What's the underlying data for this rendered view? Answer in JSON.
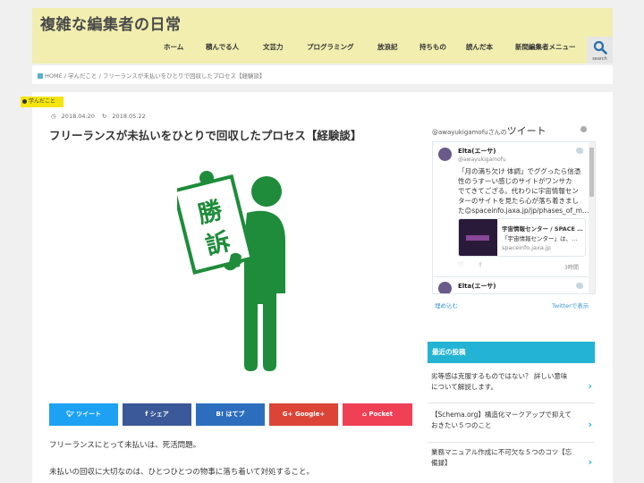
{
  "site": {
    "title": "複雑な編集者の日常",
    "search_label": "search",
    "nav": [
      "ホーム",
      "積んでる人",
      "文芸力",
      "プログラミング",
      "放浪記",
      "持ちもの",
      "読んだ本",
      "新間編集者メニュー"
    ]
  },
  "breadcrumb": "HOME / 学んだこと / フリーランスが未払いをひとりで回収したプロセス【経験談】",
  "post": {
    "category": "学んだこと",
    "published": "2018.04.20",
    "updated": "2018.05.22",
    "title": "フリーランスが未払いをひとりで回収したプロセス【経験談】",
    "hero_sign_text": [
      "勝",
      "訴"
    ],
    "paragraphs": [
      "フリーランスにとって未払いは、死活問題。",
      "未払いの回収に大切なのは、ひとつひとつの物事に落ち着いて対処すること。"
    ]
  },
  "share": [
    {
      "label": "ツイート",
      "icon": "twitter-icon",
      "color": "#1da1f2"
    },
    {
      "label": "シェア",
      "icon": "facebook-icon",
      "color": "#3b5998"
    },
    {
      "label": "B! はてブ",
      "icon": "hatena-icon",
      "color": "#2c6ebd"
    },
    {
      "label": "Google+",
      "icon": "google-plus-icon",
      "color": "#db4437"
    },
    {
      "label": "Pocket",
      "icon": "pocket-icon",
      "color": "#ef4056"
    }
  ],
  "twitter": {
    "handle_prefix": "@awayukigamofuさんの",
    "title": "ツイート",
    "tweet1": {
      "name": "Elta(エーサ)",
      "handle": "@awayukigamofu",
      "lines": [
        "「月の満ち欠け 体調」でググったら信憑",
        "性のうすーい感じのサイトがワンサカ",
        "でてきてござる。代わりに宇宙情報セン",
        "ターのサイトを見たら心が落ち着きまし",
        "た😊spaceinfo.jaxa.jp/jp/phases_of_m…"
      ],
      "card_title": "宇宙情報センター / SPACE …",
      "card_desc": "「宇宙情報センター」は、…",
      "card_domain": "spaceinfo.jaxa.jp",
      "time": "3時間"
    },
    "tweet2": {
      "name": "Elta(エーサ)"
    },
    "embed_label": "埋め込む",
    "view_label": "Twitterで表示"
  },
  "recent": {
    "header": "最近の投稿",
    "items": [
      [
        "劣等感は克服するものではない？ 詳しい意味",
        "について解説します。"
      ],
      [
        "【Schema.org】構造化マークアップで抑えて",
        "おきたい５つのこと"
      ],
      [
        "業務マニュアル作成に不可欠な５つのコツ【忘",
        "備録】"
      ]
    ]
  },
  "colors": {
    "header_bg": "#f1eeb0",
    "hero_green": "#1e8c3a",
    "accent": "#23b3d4",
    "badge": "#f5e50c"
  }
}
